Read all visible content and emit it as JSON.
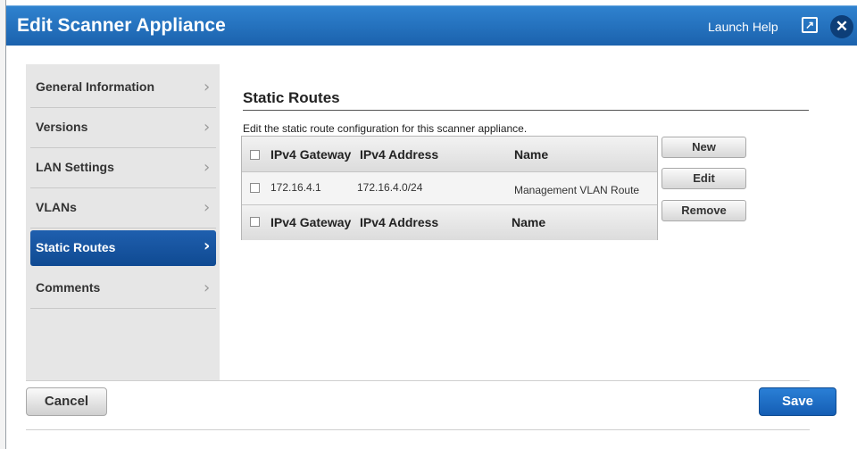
{
  "header": {
    "title": "Edit Scanner Appliance",
    "help_link": "Launch Help",
    "popout_icon": "popout-icon",
    "close_icon": "close-icon",
    "accent_color": "#1f6fc0"
  },
  "sidebar": {
    "items": [
      {
        "label": "General Information",
        "chevron": "›"
      },
      {
        "label": "Versions",
        "chevron": "›"
      },
      {
        "label": "LAN Settings",
        "chevron": "›"
      },
      {
        "label": "VLANs",
        "chevron": "›"
      },
      {
        "label": "Static Routes",
        "chevron": "›",
        "active": true
      },
      {
        "label": "Comments",
        "chevron": "›"
      }
    ]
  },
  "main": {
    "section_title": "Static Routes",
    "description": "Edit the static route configuration for this scanner appliance.",
    "table": {
      "columns": [
        "IPv4 Gateway",
        "IPv4 Address",
        "Name"
      ],
      "rows": [
        [
          "172.16.4.1",
          "172.16.4.0/24",
          "Management VLAN Route"
        ]
      ]
    },
    "buttons": {
      "new": "New",
      "edit": "Edit",
      "remove": "Remove"
    }
  },
  "footer": {
    "cancel": "Cancel",
    "save": "Save"
  }
}
